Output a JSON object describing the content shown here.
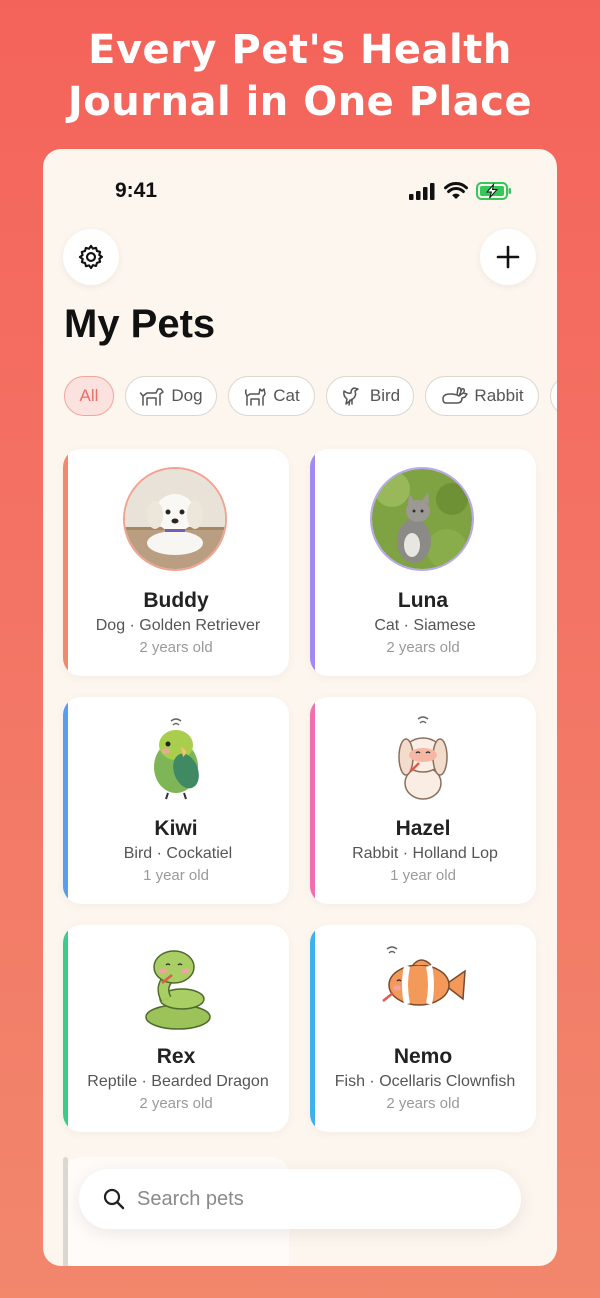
{
  "headline": {
    "line1": "Every Pet's Health",
    "line2": "Journal in One Place"
  },
  "status_bar": {
    "time": "9:41"
  },
  "header": {
    "title": "My Pets",
    "settings_icon": "gear-icon",
    "add_icon": "plus-icon"
  },
  "filters": [
    {
      "label": "All",
      "icon": "",
      "active": true
    },
    {
      "label": "Dog",
      "icon": "dog-icon"
    },
    {
      "label": "Cat",
      "icon": "cat-icon"
    },
    {
      "label": "Bird",
      "icon": "bird-icon"
    },
    {
      "label": "Rabbit",
      "icon": "rabbit-icon"
    }
  ],
  "pets": [
    {
      "name": "Buddy",
      "breed": "Dog · Golden Retriever",
      "age": "2 years old",
      "accent": "#F08A6E",
      "image": "puppy-photo"
    },
    {
      "name": "Luna",
      "breed": "Cat · Siamese",
      "age": "2 years old",
      "accent": "#A18BF0",
      "image": "kitten-photo"
    },
    {
      "name": "Kiwi",
      "breed": "Bird · Cockatiel",
      "age": "1 year old",
      "accent": "#5B9BF0",
      "image": "sick-bird-illustration"
    },
    {
      "name": "Hazel",
      "breed": "Rabbit · Holland Lop",
      "age": "1 year old",
      "accent": "#F06FB0",
      "image": "sick-rabbit-illustration"
    },
    {
      "name": "Rex",
      "breed": "Reptile · Bearded Dragon",
      "age": "2 years old",
      "accent": "#3CCB8A",
      "image": "sick-snake-illustration"
    },
    {
      "name": "Nemo",
      "breed": "Fish · Ocellaris Clownfish",
      "age": "2 years old",
      "accent": "#3AB2EE",
      "image": "sick-clownfish-illustration"
    }
  ],
  "search": {
    "placeholder": "Search pets",
    "value": ""
  },
  "colors": {
    "brand": "#F4635A",
    "surface": "#FCF6EE",
    "chip_active_bg": "#FCE2DE",
    "chip_active_text": "#EC6F65"
  }
}
